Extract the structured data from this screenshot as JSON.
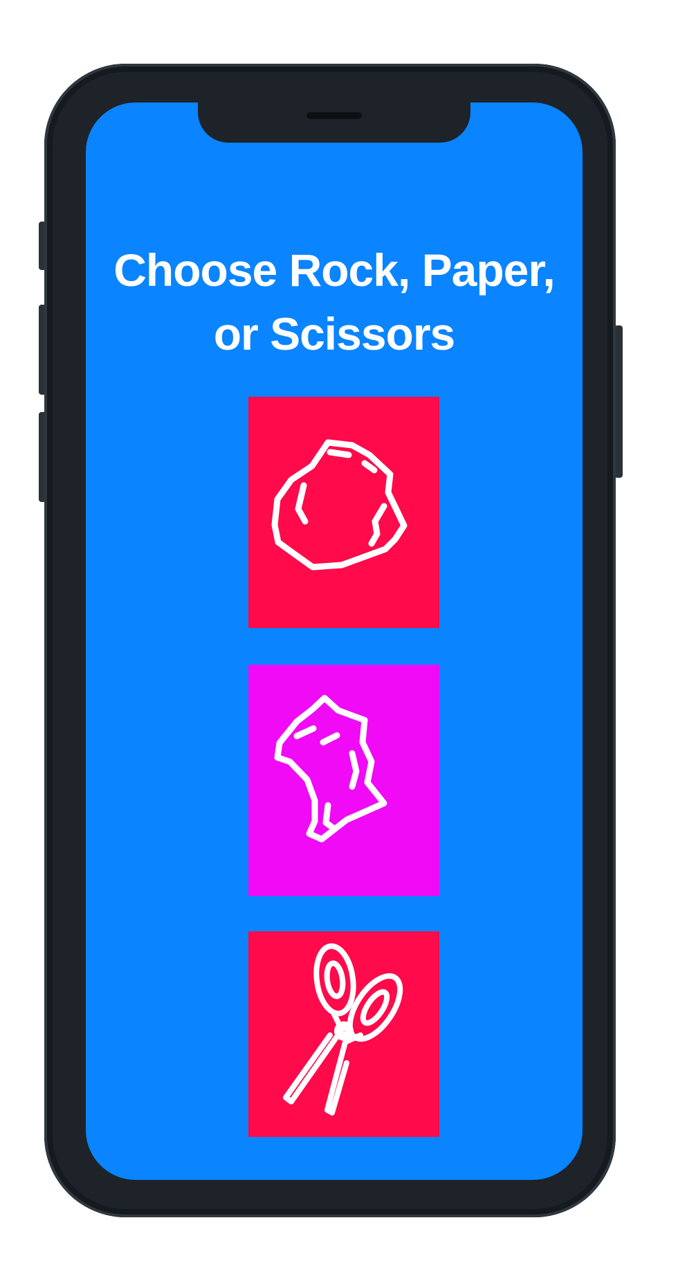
{
  "screen": {
    "title": "Choose Rock, Paper, or Scissors",
    "background_color": "#0a84ff"
  },
  "choices": [
    {
      "id": "rock",
      "icon": "rock-icon",
      "color": "#ff0a4a"
    },
    {
      "id": "paper",
      "icon": "paper-icon",
      "color": "#f00af5"
    },
    {
      "id": "scissors",
      "icon": "scissors-icon",
      "color": "#ff0a4a"
    }
  ],
  "device": {
    "frame_color": "#1d2328"
  }
}
